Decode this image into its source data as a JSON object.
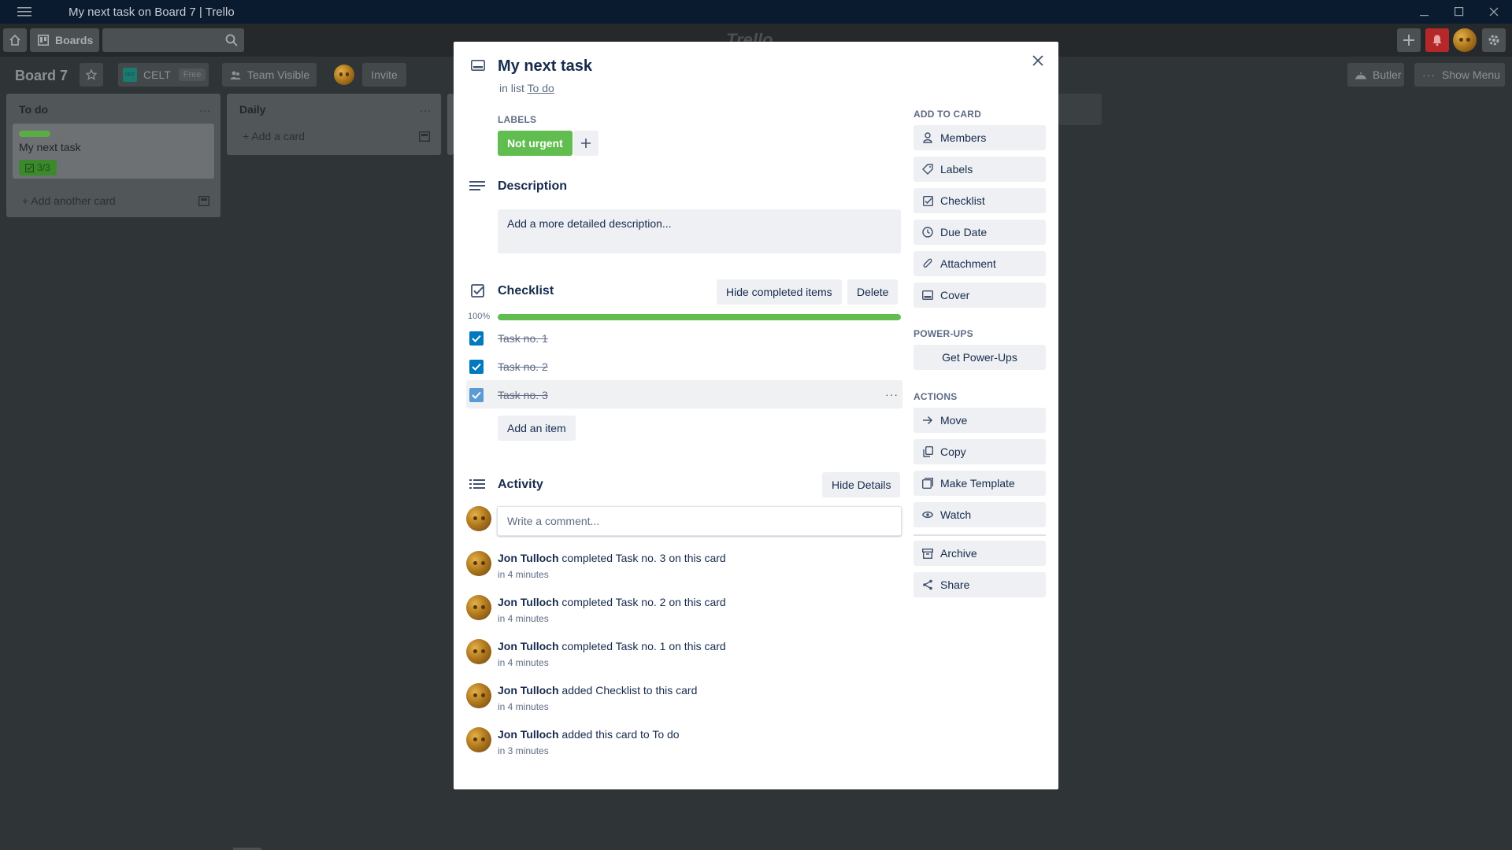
{
  "window": {
    "title": "My next task on Board 7 | Trello"
  },
  "header": {
    "boards_label": "Boards",
    "logo_text": "Trello"
  },
  "board": {
    "title": "Board 7",
    "team_badge": "CELT",
    "team_logo_text": "CELT",
    "plan_badge": "Free",
    "visibility": "Team Visible",
    "invite_label": "Invite",
    "butler_label": "Butler",
    "show_menu_label": "Show Menu"
  },
  "lists": [
    {
      "title": "To do",
      "more": "...",
      "cards": [
        {
          "title": "My next task",
          "label_color": "#5aac44",
          "checklist_badge": "3/3"
        }
      ],
      "add_label": "Add another card"
    },
    {
      "title": "Daily",
      "more": "...",
      "cards": [],
      "add_label": "Add a card"
    }
  ],
  "modal": {
    "card_title": "My next task",
    "in_list_prefix": "in list",
    "list_name": "To do",
    "labels_heading": "LABELS",
    "labels": [
      {
        "text": "Not urgent",
        "color": "#61bd4f"
      }
    ],
    "description_heading": "Description",
    "description_placeholder": "Add a more detailed description...",
    "checklist": {
      "title": "Checklist",
      "hide_completed_label": "Hide completed items",
      "delete_label": "Delete",
      "progress_text": "100%",
      "progress": 1.0,
      "items": [
        {
          "text": "Task no. 1",
          "checked": true
        },
        {
          "text": "Task no. 2",
          "checked": true
        },
        {
          "text": "Task no. 3",
          "checked": true
        }
      ],
      "add_item_label": "Add an item"
    },
    "activity": {
      "title": "Activity",
      "hide_details_label": "Hide Details",
      "comment_placeholder": "Write a comment...",
      "entries": [
        {
          "user": "Jon Tulloch",
          "text": "completed Task no. 3 on this card",
          "time": "in 4 minutes"
        },
        {
          "user": "Jon Tulloch",
          "text": "completed Task no. 2 on this card",
          "time": "in 4 minutes"
        },
        {
          "user": "Jon Tulloch",
          "text": "completed Task no. 1 on this card",
          "time": "in 4 minutes"
        },
        {
          "user": "Jon Tulloch",
          "text": "added Checklist to this card",
          "time": "in 4 minutes"
        },
        {
          "user": "Jon Tulloch",
          "text": "added this card to To do",
          "time": "in 3 minutes"
        }
      ]
    },
    "sidebar": {
      "add_to_card_heading": "ADD TO CARD",
      "add_to_card": [
        {
          "label": "Members",
          "icon": "person-icon"
        },
        {
          "label": "Labels",
          "icon": "tag-icon"
        },
        {
          "label": "Checklist",
          "icon": "checklist-icon"
        },
        {
          "label": "Due Date",
          "icon": "clock-icon"
        },
        {
          "label": "Attachment",
          "icon": "paperclip-icon"
        },
        {
          "label": "Cover",
          "icon": "cover-icon"
        }
      ],
      "power_ups_heading": "POWER-UPS",
      "get_power_ups_label": "Get Power-Ups",
      "actions_heading": "ACTIONS",
      "actions": [
        {
          "label": "Move",
          "icon": "arrow-right-icon"
        },
        {
          "label": "Copy",
          "icon": "copy-icon"
        },
        {
          "label": "Make Template",
          "icon": "template-icon"
        },
        {
          "label": "Watch",
          "icon": "eye-icon"
        }
      ],
      "secondary_actions": [
        {
          "label": "Archive",
          "icon": "archive-icon"
        },
        {
          "label": "Share",
          "icon": "share-icon"
        }
      ]
    }
  },
  "colors": {
    "label_green": "#61bd4f",
    "progress_green": "#61bd4f",
    "checkbox_blue": "#0079bf",
    "titlebar": "#0a1a2f",
    "overlay": "#2f3436"
  }
}
